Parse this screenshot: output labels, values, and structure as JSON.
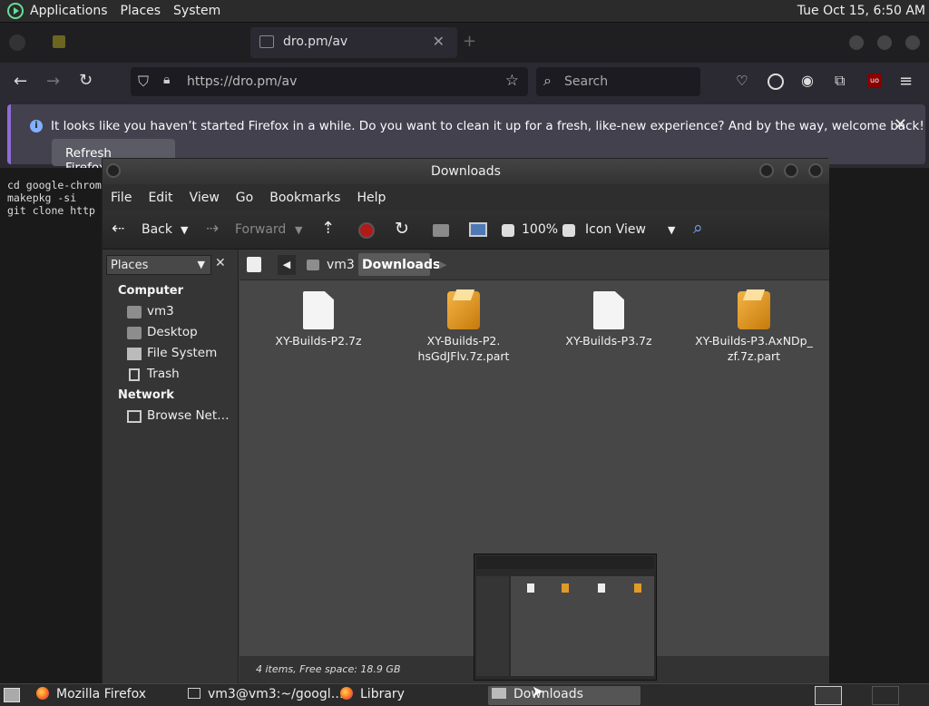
{
  "top_panel": {
    "menus": [
      "Applications",
      "Places",
      "System"
    ],
    "clock": "Tue Oct 15,  6:50 AM"
  },
  "firefox": {
    "tab_title": "dro.pm/av",
    "url": "https://dro.pm/av",
    "search_placeholder": "Search",
    "notification": {
      "message": "It looks like you haven’t started Firefox in a while. Do you want to clean it up for a fresh, like-new experience? And by the way, welcome back!",
      "button": "Refresh Firefox…"
    }
  },
  "terminal": {
    "lines": [
      "cd google-chrom",
      "makepkg -si",
      "",
      "git clone http"
    ]
  },
  "nautilus": {
    "title": "Downloads",
    "menu": [
      "File",
      "Edit",
      "View",
      "Go",
      "Bookmarks",
      "Help"
    ],
    "toolbar": {
      "back": "Back",
      "forward": "Forward",
      "zoom": "100%",
      "view_mode": "Icon View"
    },
    "sidebar": {
      "combo": "Places",
      "computer_header": "Computer",
      "computer_items": [
        "vm3",
        "Desktop",
        "File System",
        "Trash"
      ],
      "network_header": "Network",
      "network_items": [
        "Browse Net…"
      ]
    },
    "path": [
      "vm3",
      "Downloads"
    ],
    "files": [
      {
        "name": "XY-Builds-P2.7z",
        "icon": "document"
      },
      {
        "name": "XY-Builds-P2.\nhsGdJFlv.7z.part",
        "icon": "package"
      },
      {
        "name": "XY-Builds-P3.7z",
        "icon": "document"
      },
      {
        "name": "XY-Builds-P3.AxNDp_\nzf.7z.part",
        "icon": "package"
      }
    ],
    "status": "4 items, Free space: 18.9 GB"
  },
  "taskbar": {
    "tasks": [
      "Mozilla Firefox",
      "vm3@vm3:~/googl…",
      "Library",
      "Downloads"
    ]
  }
}
